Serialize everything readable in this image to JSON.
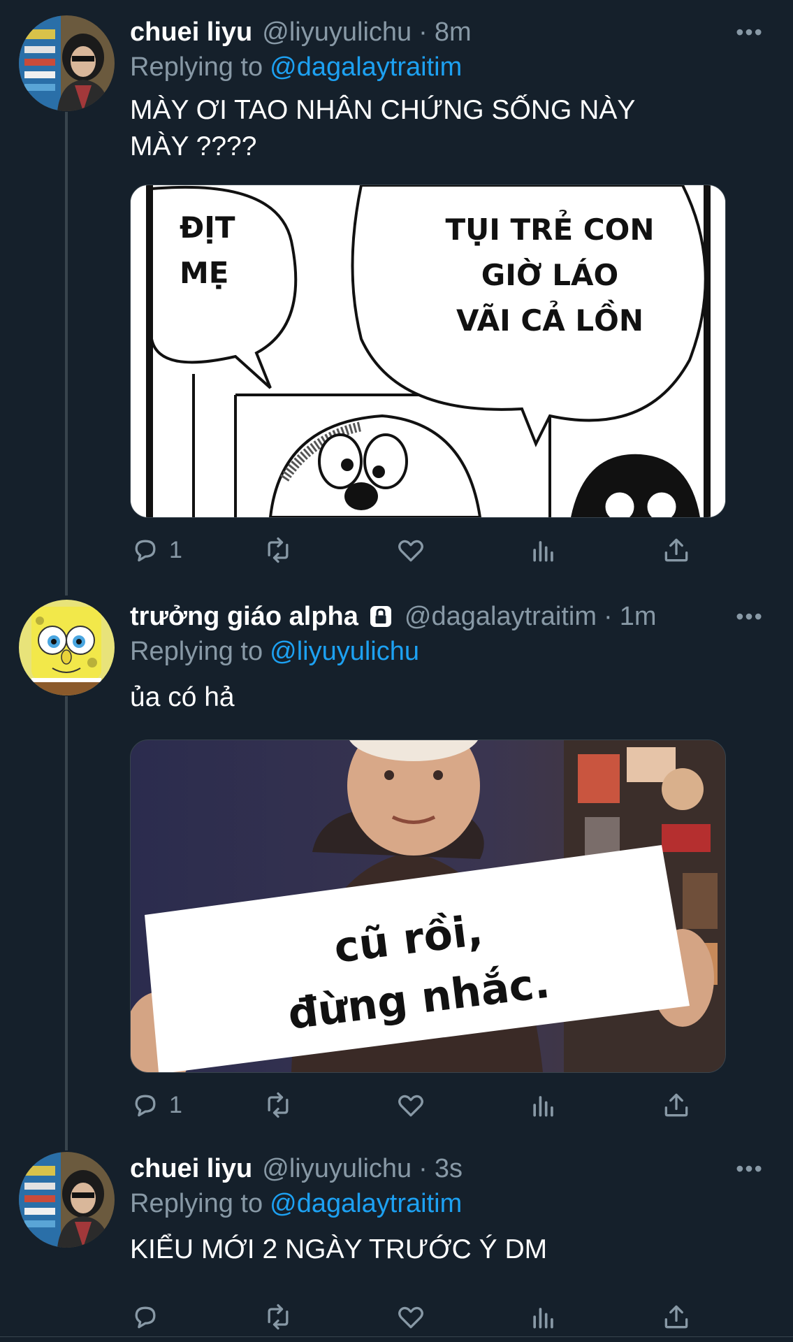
{
  "tweets": [
    {
      "display_name": "chuei liyu",
      "handle": "@liyuyulichu",
      "dot": "·",
      "time": "8m",
      "replying_prefix": "Replying to",
      "replying_to": "@dagalaytraitim",
      "text_line1": "MÀY ƠI TAO NHÂN CHỨNG SỐNG NÀY",
      "text_line2": "MÀY ????",
      "media": {
        "bubble_left_line1": "ĐỊT",
        "bubble_left_line2": "MẸ",
        "bubble_right_line1": "TỤI TRẺ CON",
        "bubble_right_line2": "GIỜ LÁO",
        "bubble_right_line3": "VÃI CẢ LỒN"
      },
      "reply_count": "1"
    },
    {
      "display_name": "trưởng giáo alpha",
      "handle": "@dagalaytraitim",
      "dot": "·",
      "time": "1m",
      "replying_prefix": "Replying to",
      "replying_to": "@liyuyulichu",
      "text_line1": "ủa có hả",
      "media": {
        "sign_line1": "cũ rồi,",
        "sign_line2": "đừng nhắc."
      },
      "reply_count": "1"
    },
    {
      "display_name": "chuei liyu",
      "handle": "@liyuyulichu",
      "dot": "·",
      "time": "3s",
      "replying_prefix": "Replying to",
      "replying_to": "@dagalaytraitim",
      "text_line1": "KIỂU MỚI 2 NGÀY TRƯỚC Ý DM"
    }
  ],
  "icons": {
    "more": "more-horizontal-icon",
    "reply": "reply-bubble-icon",
    "retweet": "retweet-icon",
    "like": "heart-icon",
    "analytics": "analytics-bars-icon",
    "share": "share-upload-icon",
    "lock": "lock-icon"
  },
  "colors": {
    "background": "#15202b",
    "secondary_text": "#8899a6",
    "accent": "#1da1f2",
    "divider": "#38444d"
  }
}
